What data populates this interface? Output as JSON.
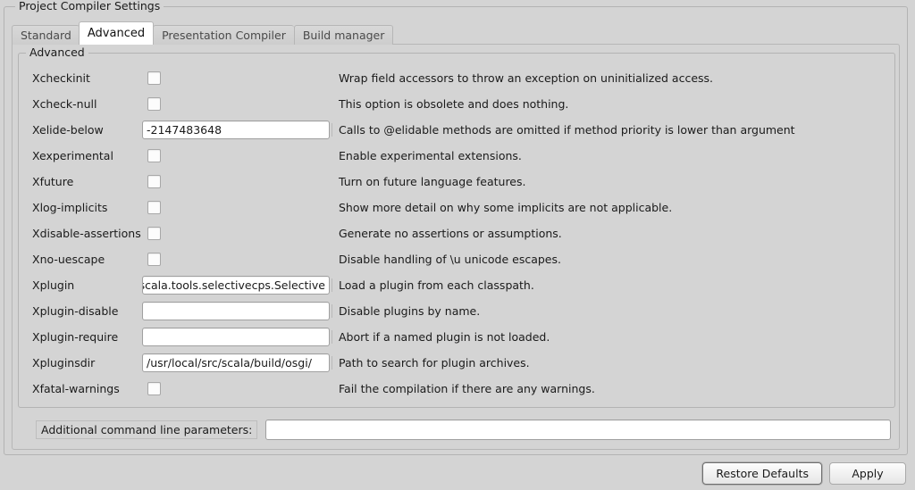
{
  "window": {
    "title": "Project Compiler Settings"
  },
  "tabs": [
    {
      "label": "Standard",
      "active": false
    },
    {
      "label": "Advanced",
      "active": true
    },
    {
      "label": "Presentation Compiler",
      "active": false
    },
    {
      "label": "Build manager",
      "active": false
    }
  ],
  "group": {
    "title": "Advanced"
  },
  "options": [
    {
      "name": "Xcheckinit",
      "type": "checkbox",
      "checked": false,
      "description": "Wrap field accessors to throw an exception on uninitialized access."
    },
    {
      "name": "Xcheck-null",
      "type": "checkbox",
      "checked": false,
      "description": "This option is obsolete and does nothing."
    },
    {
      "name": "Xelide-below",
      "type": "text",
      "value": "-2147483648",
      "description": "Calls to @elidable methods are omitted if method priority is lower than argument"
    },
    {
      "name": "Xexperimental",
      "type": "checkbox",
      "checked": false,
      "description": "Enable experimental extensions."
    },
    {
      "name": "Xfuture",
      "type": "checkbox",
      "checked": false,
      "description": "Turn on future language features."
    },
    {
      "name": "Xlog-implicits",
      "type": "checkbox",
      "checked": false,
      "description": "Show more detail on why some implicits are not applicable."
    },
    {
      "name": "Xdisable-assertions",
      "type": "checkbox",
      "checked": false,
      "description": "Generate no assertions or assumptions."
    },
    {
      "name": "Xno-uescape",
      "type": "checkbox",
      "checked": false,
      "description": "Disable handling of \\u unicode escapes."
    },
    {
      "name": "Xplugin",
      "type": "text",
      "value": ":v/scala.tools.selectivecps.Selective",
      "description": "Load a plugin from each classpath."
    },
    {
      "name": "Xplugin-disable",
      "type": "text",
      "value": "",
      "description": "Disable plugins by name."
    },
    {
      "name": "Xplugin-require",
      "type": "text",
      "value": "",
      "description": "Abort if a named plugin is not loaded."
    },
    {
      "name": "Xpluginsdir",
      "type": "text",
      "value": "/usr/local/src/scala/build/osgi/",
      "description": "Path to search for plugin archives."
    },
    {
      "name": "Xfatal-warnings",
      "type": "checkbox",
      "checked": false,
      "description": "Fail the compilation if there are any warnings."
    }
  ],
  "additional_params": {
    "label": "Additional command line parameters:",
    "value": ""
  },
  "buttons": {
    "restore_defaults": "Restore Defaults",
    "apply": "Apply"
  },
  "colors": {
    "window_bg": "#d4d4d4",
    "field_bg": "#ffffff",
    "border": "#b3b3b3",
    "text": "#1a1a1a",
    "tab_inactive_text": "#4a4a4a"
  }
}
